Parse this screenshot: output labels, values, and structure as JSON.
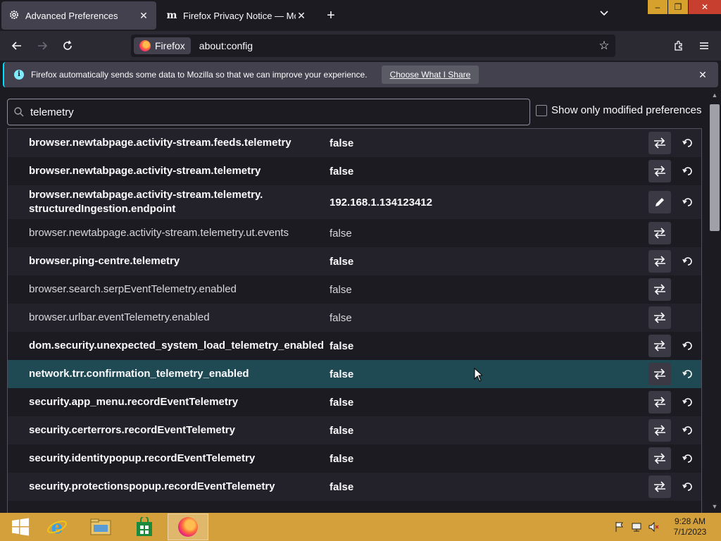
{
  "tabs": [
    {
      "label": "Advanced Preferences",
      "icon": "gear-icon",
      "active": true
    },
    {
      "label": "Firefox Privacy Notice — Mozilla",
      "icon": "mozilla-m-icon",
      "active": false
    }
  ],
  "navbar": {
    "identity_label": "Firefox",
    "url": "about:config"
  },
  "notification": {
    "text": "Firefox automatically sends some data to Mozilla so that we can improve your experience.",
    "button_label": "Choose What I Share"
  },
  "search": {
    "value": "telemetry"
  },
  "modified_checkbox": {
    "label": "Show only modified preferences",
    "checked": false
  },
  "preferences": [
    {
      "name": "browser.newtabpage.activity-stream.feeds.telemetry",
      "value": "false",
      "modified": true,
      "type": "boolean"
    },
    {
      "name": "browser.newtabpage.activity-stream.telemetry",
      "value": "false",
      "modified": true,
      "type": "boolean"
    },
    {
      "name": "browser.newtabpage.activity-stream.telemetry.structuredIngestion.endpoint",
      "name_line1": "browser.newtabpage.activity-stream.telemetry.",
      "name_line2": "structuredIngestion.endpoint",
      "value": "192.168.1.134123412",
      "modified": true,
      "type": "string"
    },
    {
      "name": "browser.newtabpage.activity-stream.telemetry.ut.events",
      "value": "false",
      "modified": false,
      "type": "boolean"
    },
    {
      "name": "browser.ping-centre.telemetry",
      "value": "false",
      "modified": true,
      "type": "boolean"
    },
    {
      "name": "browser.search.serpEventTelemetry.enabled",
      "value": "false",
      "modified": false,
      "type": "boolean"
    },
    {
      "name": "browser.urlbar.eventTelemetry.enabled",
      "value": "false",
      "modified": false,
      "type": "boolean"
    },
    {
      "name": "dom.security.unexpected_system_load_telemetry_enabled",
      "value": "false",
      "modified": true,
      "type": "boolean"
    },
    {
      "name": "network.trr.confirmation_telemetry_enabled",
      "value": "false",
      "modified": true,
      "type": "boolean",
      "selected": true
    },
    {
      "name": "security.app_menu.recordEventTelemetry",
      "value": "false",
      "modified": true,
      "type": "boolean"
    },
    {
      "name": "security.certerrors.recordEventTelemetry",
      "value": "false",
      "modified": true,
      "type": "boolean"
    },
    {
      "name": "security.identitypopup.recordEventTelemetry",
      "value": "false",
      "modified": true,
      "type": "boolean"
    },
    {
      "name": "security.protectionspopup.recordEventTelemetry",
      "value": "false",
      "modified": true,
      "type": "boolean"
    }
  ],
  "taskbar": {
    "clock_time": "9:28 AM",
    "clock_date": "7/1/2023"
  },
  "colors": {
    "accent": "#00ddff",
    "selected_row": "#1f4a54",
    "taskbar": "#d4a03b"
  }
}
